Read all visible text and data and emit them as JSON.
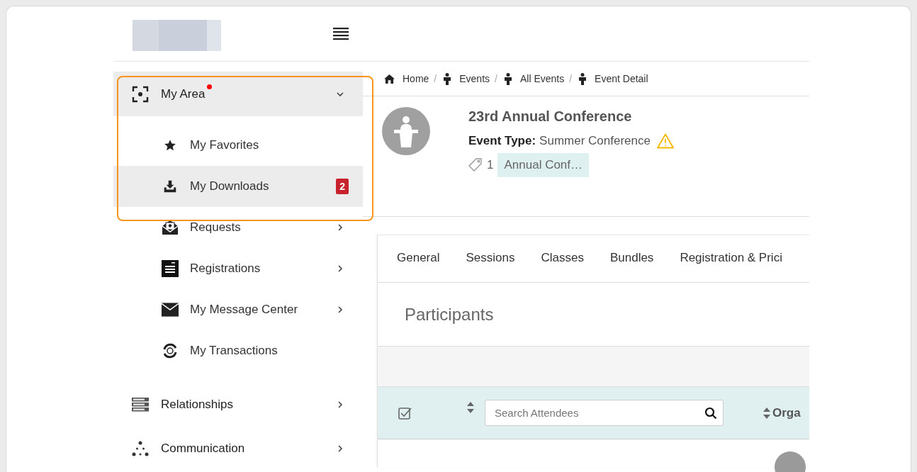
{
  "sidebar": {
    "items": [
      {
        "label": "My Area",
        "expanded": true,
        "has_submenu": true,
        "notification_dot": true,
        "children": [
          {
            "label": "My Favorites",
            "has_submenu": false,
            "selected": false
          },
          {
            "label": "My Downloads",
            "has_submenu": false,
            "selected": true,
            "badge": "2"
          },
          {
            "label": "Requests",
            "has_submenu": true,
            "selected": false
          },
          {
            "label": "Registrations",
            "has_submenu": true,
            "selected": false
          },
          {
            "label": "My Message Center",
            "has_submenu": true,
            "selected": false
          },
          {
            "label": "My Transactions",
            "has_submenu": false,
            "selected": false
          }
        ]
      },
      {
        "label": "Relationships",
        "expanded": false,
        "has_submenu": true,
        "notification_dot": false
      },
      {
        "label": "Communication",
        "expanded": false,
        "has_submenu": true,
        "notification_dot": false
      }
    ]
  },
  "breadcrumb": {
    "separator": "/",
    "items": [
      "Home",
      "Events",
      "All Events",
      "Event Detail"
    ]
  },
  "event": {
    "title": "23rd Annual Conference",
    "type_label": "Event Type:",
    "type_value": "Summer Conference",
    "warning": true,
    "tag_count": "1",
    "tag": "Annual Conf…"
  },
  "tabs": [
    {
      "label": "General",
      "selected": false
    },
    {
      "label": "Sessions",
      "selected": false
    },
    {
      "label": "Classes",
      "selected": false
    },
    {
      "label": "Bundles",
      "selected": false
    },
    {
      "label": "Registration & Prici",
      "selected": false
    }
  ],
  "participants": {
    "title": "Participants",
    "select_all_checked": true,
    "search": {
      "placeholder": "Search Attendees"
    },
    "column_3": "Orga"
  }
}
